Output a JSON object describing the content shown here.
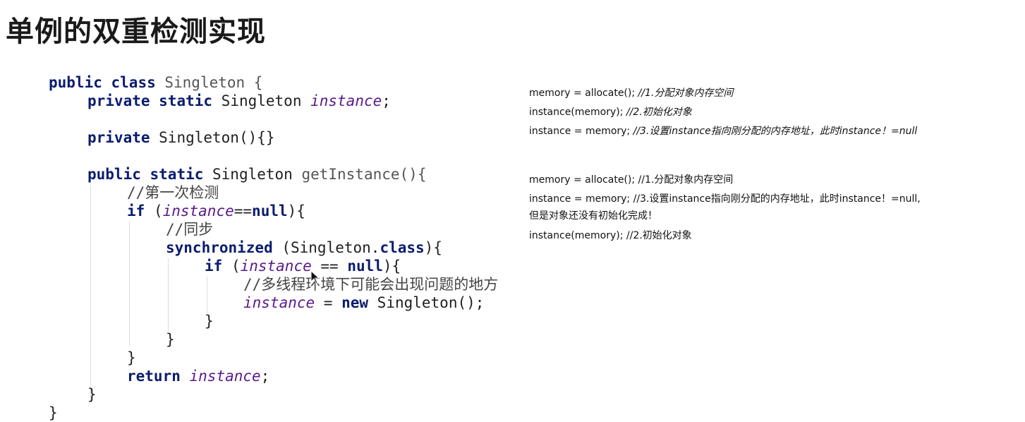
{
  "title": "单例的双重检测实现",
  "code": {
    "l1": {
      "a": "public",
      "b": " ",
      "c": "class",
      "d": " Singleton {"
    },
    "l2": {
      "a": "private",
      "b": " ",
      "c": "static",
      "d": " Singleton ",
      "e": "instance",
      "f": ";"
    },
    "l3": {
      "a": "private",
      "b": " Singleton(){}"
    },
    "l4": {
      "a": "public",
      "b": " ",
      "c": "static",
      "d": " Singleton ",
      "e": "getInstance(){"
    },
    "l5": {
      "a": "//第一次检测"
    },
    "l6": {
      "a": "if",
      "b": " (",
      "c": "instance",
      "d": "==",
      "e": "null",
      "f": "){"
    },
    "l7": {
      "a": "//同步"
    },
    "l8": {
      "a": "synchronized",
      "b": " (Singleton.",
      "c": "class",
      "d": "){"
    },
    "l9": {
      "a": "if",
      "b": " (",
      "c": "instance",
      "d": " == ",
      "e": "null",
      "f": "){"
    },
    "l10": {
      "a": "//多线程环境下可能会出现问题的地方"
    },
    "l11": {
      "a": "instance",
      "b": " = ",
      "c": "new",
      "d": " Singleton();"
    },
    "l12": {
      "a": "}"
    },
    "l13": {
      "a": "}"
    },
    "l14": {
      "a": "}"
    },
    "l15": {
      "a": "return",
      "b": " ",
      "c": "instance",
      "d": ";"
    },
    "l16": {
      "a": "}"
    },
    "l17": {
      "a": "}"
    }
  },
  "notes": {
    "group1": {
      "line1_code": "memory = allocate(); ",
      "line1_comment": "//1.分配对象内存空间",
      "line2_code": "instance(memory);   ",
      "line2_comment": "//2.初始化对象",
      "line3_code": "instance = memory;   ",
      "line3_comment": "//3.设置instance指向刚分配的内存地址，此时instance！=null"
    },
    "group2": {
      "line1": "memory = allocate(); //1.分配对象内存空间",
      "line2": "instance = memory;   //3.设置instance指向刚分配的内存地址，此时instance！=null,",
      "line3": "但是对象还没有初始化完成！",
      "line4": "instance(memory);    //2.初始化对象"
    }
  }
}
